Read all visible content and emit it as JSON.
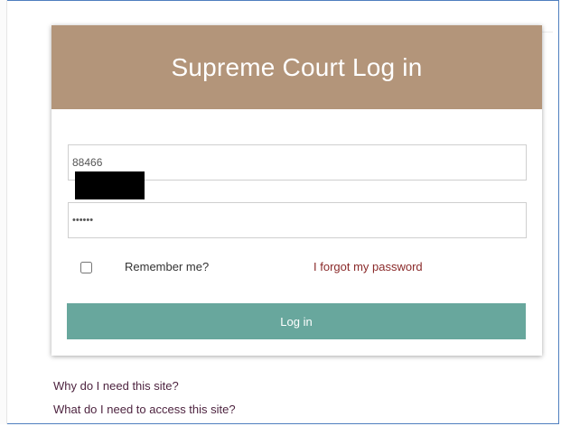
{
  "login": {
    "title": "Supreme Court Log in",
    "username": {
      "value": "88466"
    },
    "password": {
      "value": "••••••"
    },
    "remember_label": "Remember me?",
    "forgot_password_link": "I forgot my password",
    "submit_label": "Log in"
  },
  "help_links": [
    "Why do I need this site?",
    "What do I need to access this site?"
  ],
  "colors": {
    "header": "#b3957a",
    "button": "#68a79d",
    "forgot_link": "#8a2a2a",
    "help_links": "#4e2440",
    "frame_border": "#4f7fbf"
  }
}
